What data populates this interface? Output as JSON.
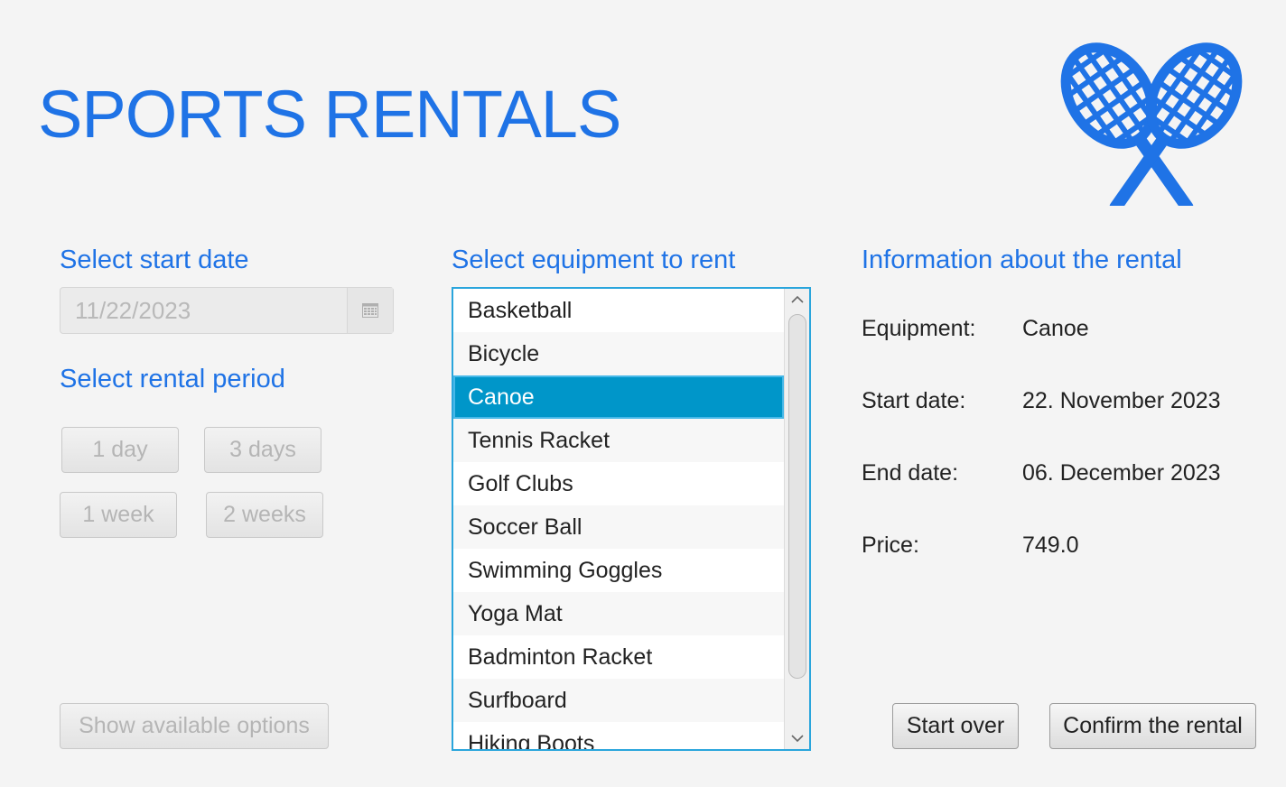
{
  "app": {
    "title": "SPORTS RENTALS",
    "logo_icon": "crossed-rackets-icon",
    "accent_color": "#1f73e6"
  },
  "left_panel": {
    "start_date_heading": "Select start date",
    "date_value": "11/22/2023",
    "calendar_icon": "calendar-icon",
    "rental_period_heading": "Select rental period",
    "periods": [
      "1 day",
      "3 days",
      "1 week",
      "2 weeks"
    ],
    "show_options_label": "Show available options"
  },
  "equipment": {
    "heading": "Select equipment to rent",
    "items": [
      "Basketball",
      "Bicycle",
      "Canoe",
      "Tennis Racket",
      "Golf Clubs",
      "Soccer Ball",
      "Swimming Goggles",
      "Yoga Mat",
      "Badminton Racket",
      "Surfboard",
      "Hiking Boots"
    ],
    "selected": "Canoe",
    "selection_color": "#0096c9"
  },
  "info": {
    "heading": "Information about the rental",
    "rows": [
      {
        "label": "Equipment:",
        "value": "Canoe"
      },
      {
        "label": "Start date:",
        "value": "22. November 2023"
      },
      {
        "label": "End date:",
        "value": "06. December 2023"
      },
      {
        "label": "Price:",
        "value": "749.0"
      }
    ]
  },
  "actions": {
    "start_over_label": "Start over",
    "confirm_label": "Confirm the rental"
  }
}
